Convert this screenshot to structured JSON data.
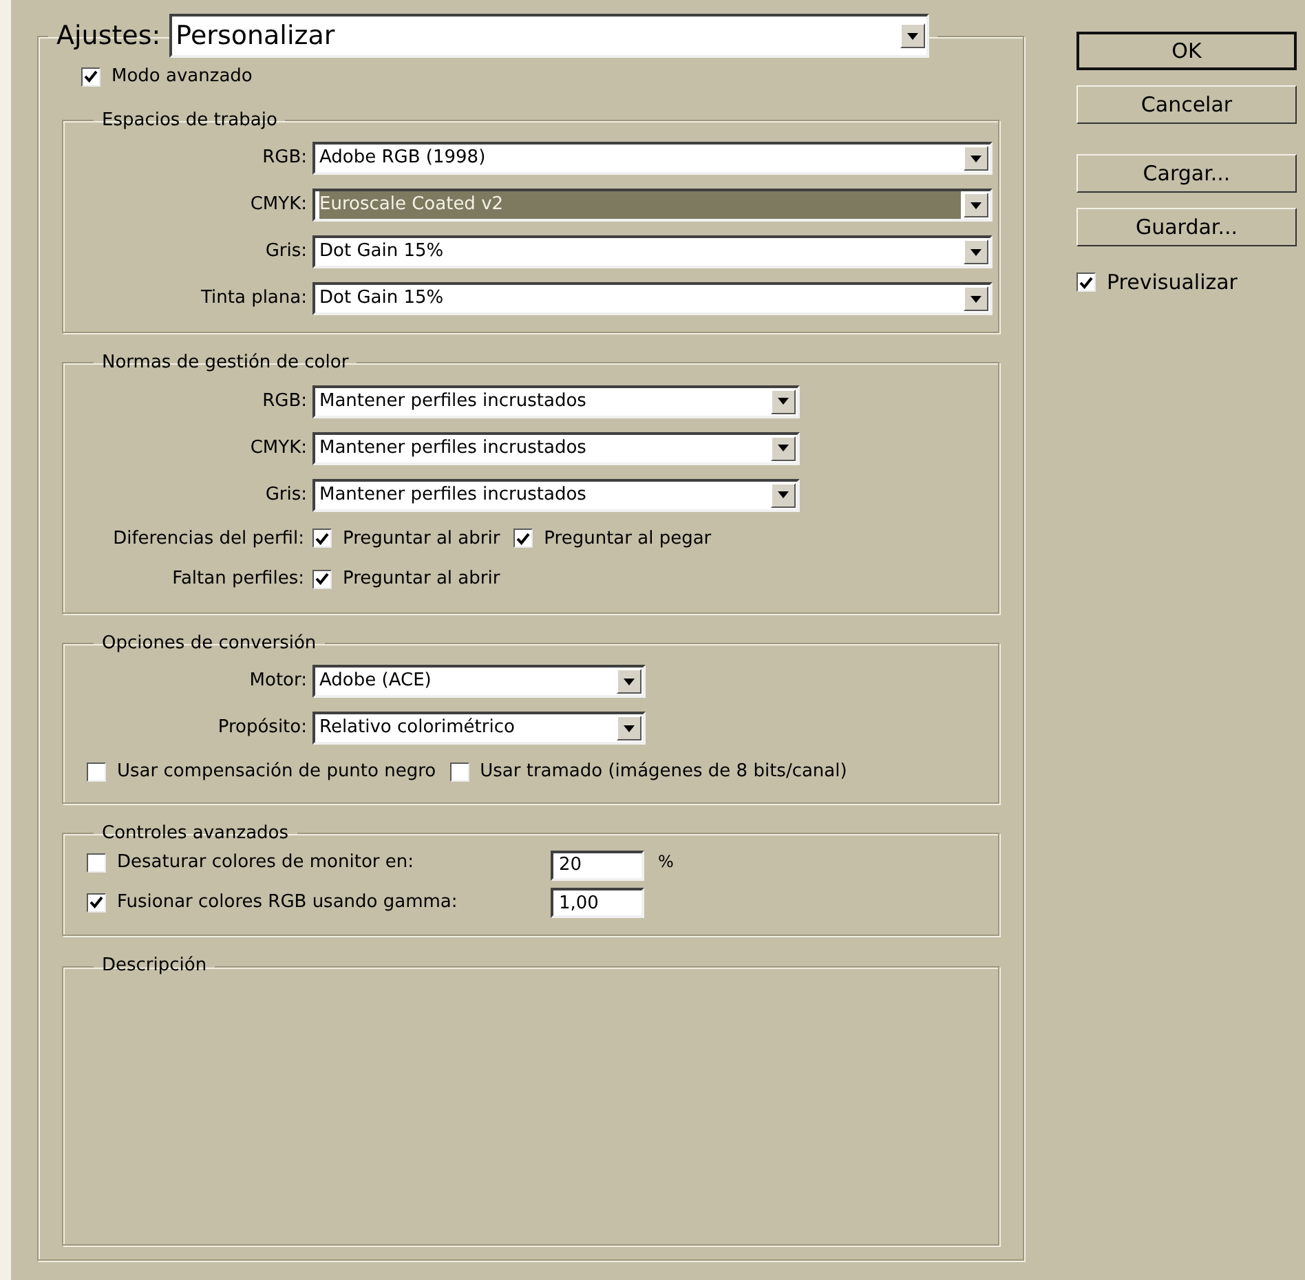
{
  "settings": {
    "label": "Ajustes:",
    "value": "Personalizar"
  },
  "advanced_mode": {
    "label": "Modo avanzado",
    "checked": true
  },
  "sections": [
    {
      "kind": "workspaces",
      "title": "Espacios de trabajo",
      "rows": [
        {
          "kind": "dropdown",
          "label": "RGB:",
          "value": "Adobe RGB (1998)",
          "selected": false
        },
        {
          "kind": "dropdown",
          "label": "CMYK:",
          "value": "Euroscale Coated v2",
          "selected": true
        },
        {
          "kind": "dropdown",
          "label": "Gris:",
          "value": "Dot Gain 15%",
          "selected": false
        },
        {
          "kind": "dropdown",
          "label": "Tinta plana:",
          "value": "Dot Gain 15%",
          "selected": false
        }
      ]
    },
    {
      "kind": "policies",
      "title": "Normas de gestión de color",
      "rows": [
        {
          "kind": "dropdown",
          "label": "RGB:",
          "value": "Mantener perfiles incrustados",
          "selected": false
        },
        {
          "kind": "dropdown",
          "label": "CMYK:",
          "value": "Mantener perfiles incrustados",
          "selected": false
        },
        {
          "kind": "dropdown",
          "label": "Gris:",
          "value": "Mantener perfiles incrustados",
          "selected": false
        },
        {
          "kind": "checks",
          "label": "Diferencias del perfil:",
          "options": [
            {
              "label": "Preguntar al abrir",
              "checked": true
            },
            {
              "label": "Preguntar al pegar",
              "checked": true
            }
          ]
        },
        {
          "kind": "checks",
          "label": "Faltan perfiles:",
          "options": [
            {
              "label": "Preguntar al abrir",
              "checked": true
            }
          ]
        }
      ]
    },
    {
      "kind": "conversion",
      "title": "Opciones de conversión",
      "rows": [
        {
          "kind": "dropdown",
          "label": "Motor:",
          "value": "Adobe (ACE)",
          "selected": false
        },
        {
          "kind": "dropdown",
          "label": "Propósito:",
          "value": "Relativo colorimétrico",
          "selected": false
        },
        {
          "kind": "checkline",
          "options": [
            {
              "label": "Usar compensación de punto negro",
              "checked": false
            },
            {
              "label": "Usar tramado (imágenes de 8 bits/canal)",
              "checked": false
            }
          ]
        }
      ]
    },
    {
      "kind": "advanced",
      "title": "Controles avanzados",
      "rows": [
        {
          "kind": "numeric",
          "label": "Desaturar colores de monitor en:",
          "checked": false,
          "value": "20",
          "unit": "%"
        },
        {
          "kind": "numeric",
          "label": "Fusionar colores RGB usando gamma:",
          "checked": true,
          "value": "1,00"
        }
      ]
    },
    {
      "kind": "description",
      "title": "Descripción"
    }
  ],
  "buttons": [
    {
      "label": "OK",
      "default": true
    },
    {
      "label": "Cancelar",
      "default": false
    },
    {
      "label": "Cargar...",
      "default": false
    },
    {
      "label": "Guardar...",
      "default": false
    }
  ],
  "preview": {
    "label": "Previsualizar",
    "checked": true
  }
}
